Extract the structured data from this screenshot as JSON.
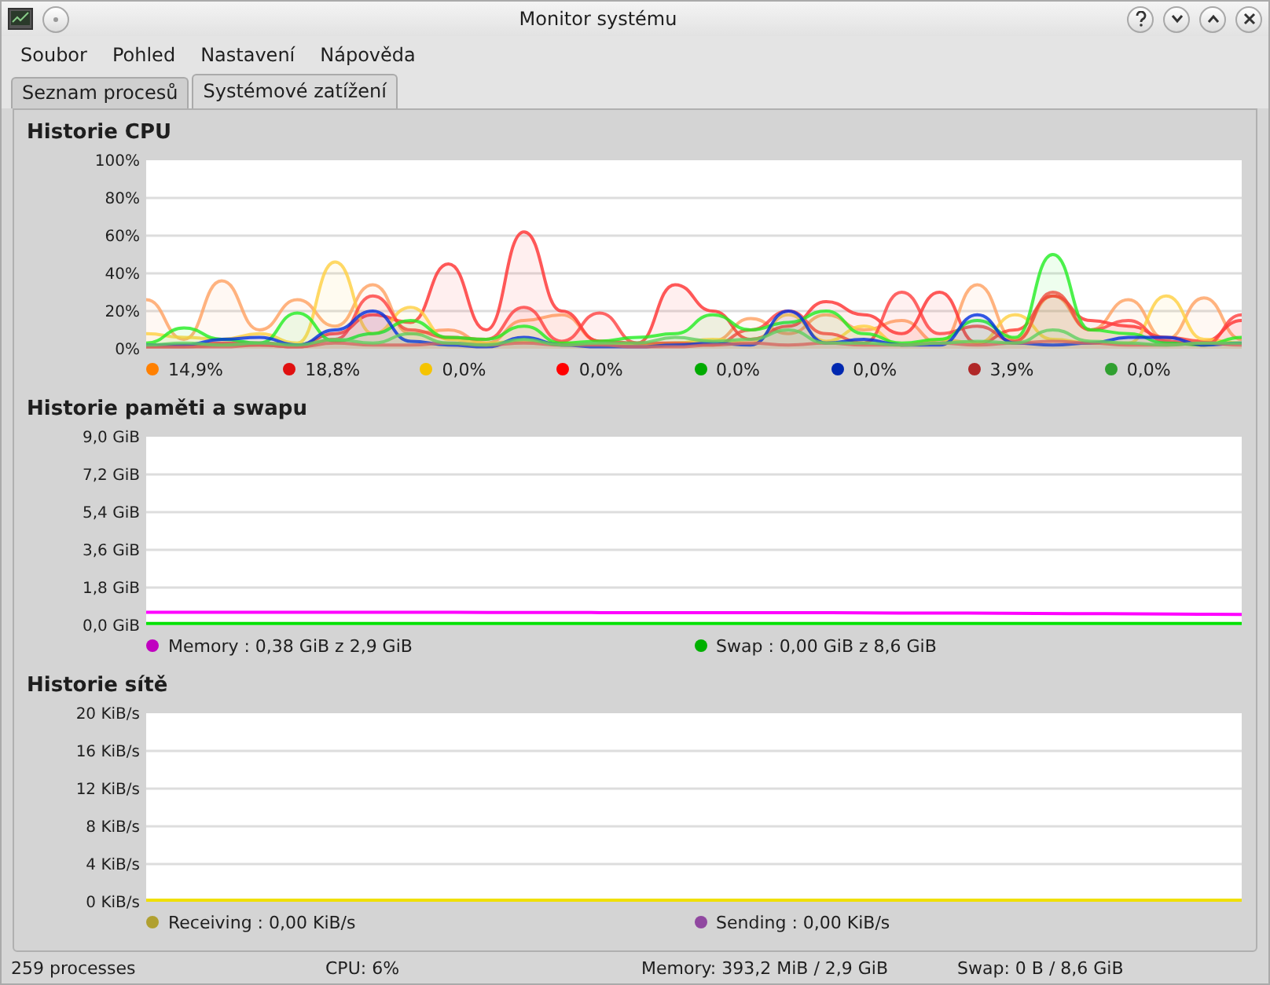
{
  "window": {
    "title": "Monitor systému"
  },
  "menu": [
    {
      "label": "Soubor"
    },
    {
      "label": "Pohled"
    },
    {
      "label": "Nastavení"
    },
    {
      "label": "Nápověda"
    }
  ],
  "tabs": [
    {
      "label": "Seznam procesů",
      "selected": false
    },
    {
      "label": "Systémové zatížení",
      "selected": true
    }
  ],
  "panels": [
    {
      "title": "Historie CPU",
      "legend": [
        {
          "label": "14,9%",
          "color": "#ff8000"
        },
        {
          "label": "18,8%",
          "color": "#e01010"
        },
        {
          "label": "0,0%",
          "color": "#f5c400"
        },
        {
          "label": "0,0%",
          "color": "#ff0000"
        },
        {
          "label": "0,0%",
          "color": "#00aa00"
        },
        {
          "label": "0,0%",
          "color": "#0028b0"
        },
        {
          "label": "3,9%",
          "color": "#b02828"
        },
        {
          "label": "0,0%",
          "color": "#30a030"
        }
      ],
      "chart_data": {
        "type": "area",
        "grid": true,
        "ylim": [
          0,
          100
        ],
        "yticks": [
          {
            "value": 0,
            "label": "0%"
          },
          {
            "value": 20,
            "label": "20%"
          },
          {
            "value": 40,
            "label": "40%"
          },
          {
            "value": 60,
            "label": "60%"
          },
          {
            "value": 80,
            "label": "80%"
          },
          {
            "value": 100,
            "label": "100%"
          }
        ],
        "series": [
          {
            "color": "#ffa060",
            "values": [
              26,
              5,
              36,
              10,
              26,
              12,
              34,
              8,
              10,
              3,
              15,
              18,
              4,
              2,
              3,
              4,
              16,
              8,
              18,
              10,
              15,
              3,
              34,
              5,
              28,
              10,
              26,
              5,
              27,
              5
            ]
          },
          {
            "color": "#ff3030",
            "values": [
              2,
              2,
              3,
              3,
              2,
              8,
              18,
              14,
              45,
              10,
              62,
              20,
              4,
              3,
              34,
              20,
              5,
              12,
              25,
              18,
              8,
              30,
              3,
              10,
              28,
              15,
              12,
              6,
              4,
              15
            ]
          },
          {
            "color": "#ffd040",
            "values": [
              8,
              6,
              5,
              8,
              3,
              46,
              8,
              22,
              5,
              3,
              4,
              3,
              2,
              2,
              3,
              5,
              3,
              18,
              4,
              12,
              2,
              5,
              3,
              18,
              5,
              3,
              3,
              28,
              5,
              3
            ]
          },
          {
            "color": "#ff4040",
            "values": [
              1,
              1,
              2,
              2,
              1,
              5,
              28,
              10,
              6,
              5,
              22,
              4,
              19,
              3,
              3,
              2,
              10,
              20,
              8,
              3,
              30,
              8,
              12,
              4,
              30,
              10,
              15,
              4,
              2,
              18
            ]
          },
          {
            "color": "#20ee20",
            "values": [
              3,
              11,
              5,
              3,
              19,
              4,
              8,
              15,
              6,
              5,
              12,
              3,
              4,
              6,
              8,
              18,
              10,
              14,
              20,
              8,
              3,
              5,
              15,
              6,
              50,
              10,
              8,
              3,
              2,
              6
            ]
          },
          {
            "color": "#0030e0",
            "values": [
              2,
              2,
              5,
              6,
              2,
              10,
              20,
              4,
              2,
              1,
              6,
              2,
              1,
              1,
              2,
              3,
              2,
              20,
              3,
              5,
              2,
              2,
              18,
              3,
              2,
              3,
              6,
              6,
              2,
              3
            ]
          },
          {
            "color": "#e06060",
            "values": [
              1,
              1,
              1,
              2,
              1,
              3,
              2,
              2,
              3,
              2,
              3,
              2,
              2,
              1,
              1,
              2,
              3,
              2,
              3,
              2,
              2,
              3,
              2,
              3,
              4,
              3,
              2,
              2,
              3,
              2
            ]
          },
          {
            "color": "#60d060",
            "values": [
              2,
              3,
              2,
              3,
              2,
              5,
              3,
              8,
              3,
              2,
              5,
              2,
              3,
              3,
              6,
              4,
              5,
              10,
              3,
              3,
              2,
              3,
              4,
              3,
              10,
              4,
              3,
              2,
              3,
              3
            ]
          }
        ]
      }
    },
    {
      "title": "Historie paměti a swapu",
      "legend": [
        {
          "label": "Memory : 0,38 GiB z 2,9 GiB",
          "color": "#c000c0"
        },
        {
          "label": "Swap : 0,00 GiB z 8,6 GiB",
          "color": "#00b000"
        }
      ],
      "chart_data": {
        "type": "line",
        "grid": true,
        "ylim": [
          0,
          9
        ],
        "yticks": [
          {
            "value": 0,
            "label": "0,0 GiB"
          },
          {
            "value": 1.8,
            "label": "1,8 GiB"
          },
          {
            "value": 3.6,
            "label": "3,6 GiB"
          },
          {
            "value": 5.4,
            "label": "5,4 GiB"
          },
          {
            "value": 7.2,
            "label": "7,2 GiB"
          },
          {
            "value": 9,
            "label": "9,0 GiB"
          }
        ],
        "series": [
          {
            "color": "#ff00ff",
            "values": [
              0.62,
              0.62,
              0.62,
              0.62,
              0.62,
              0.61,
              0.61,
              0.6,
              0.6,
              0.6,
              0.6,
              0.58,
              0.58,
              0.56,
              0.55,
              0.53,
              0.52
            ]
          },
          {
            "color": "#00e000",
            "values": [
              0.08,
              0.08,
              0.08,
              0.08,
              0.08,
              0.08,
              0.08,
              0.08,
              0.08,
              0.08,
              0.08,
              0.08,
              0.08,
              0.08,
              0.08,
              0.08,
              0.08
            ]
          }
        ]
      }
    },
    {
      "title": "Historie sítě",
      "legend": [
        {
          "label": "Receiving : 0,00 KiB/s",
          "color": "#b0a030"
        },
        {
          "label": "Sending : 0,00 KiB/s",
          "color": "#9048a0"
        }
      ],
      "chart_data": {
        "type": "line",
        "grid": true,
        "ylim": [
          0,
          20
        ],
        "yticks": [
          {
            "value": 0,
            "label": "0 KiB/s"
          },
          {
            "value": 4,
            "label": "4 KiB/s"
          },
          {
            "value": 8,
            "label": "8 KiB/s"
          },
          {
            "value": 12,
            "label": "12 KiB/s"
          },
          {
            "value": 16,
            "label": "16 KiB/s"
          },
          {
            "value": 20,
            "label": "20 KiB/s"
          }
        ],
        "series": [
          {
            "color": "#f0e000",
            "values": [
              0,
              0,
              0,
              0,
              0,
              0,
              0,
              0
            ]
          }
        ]
      }
    }
  ],
  "status_bar": [
    "259 processes",
    "CPU: 6%",
    "Memory: 393,2 MiB / 2,9 GiB",
    "Swap: 0 B / 8,6 GiB"
  ]
}
